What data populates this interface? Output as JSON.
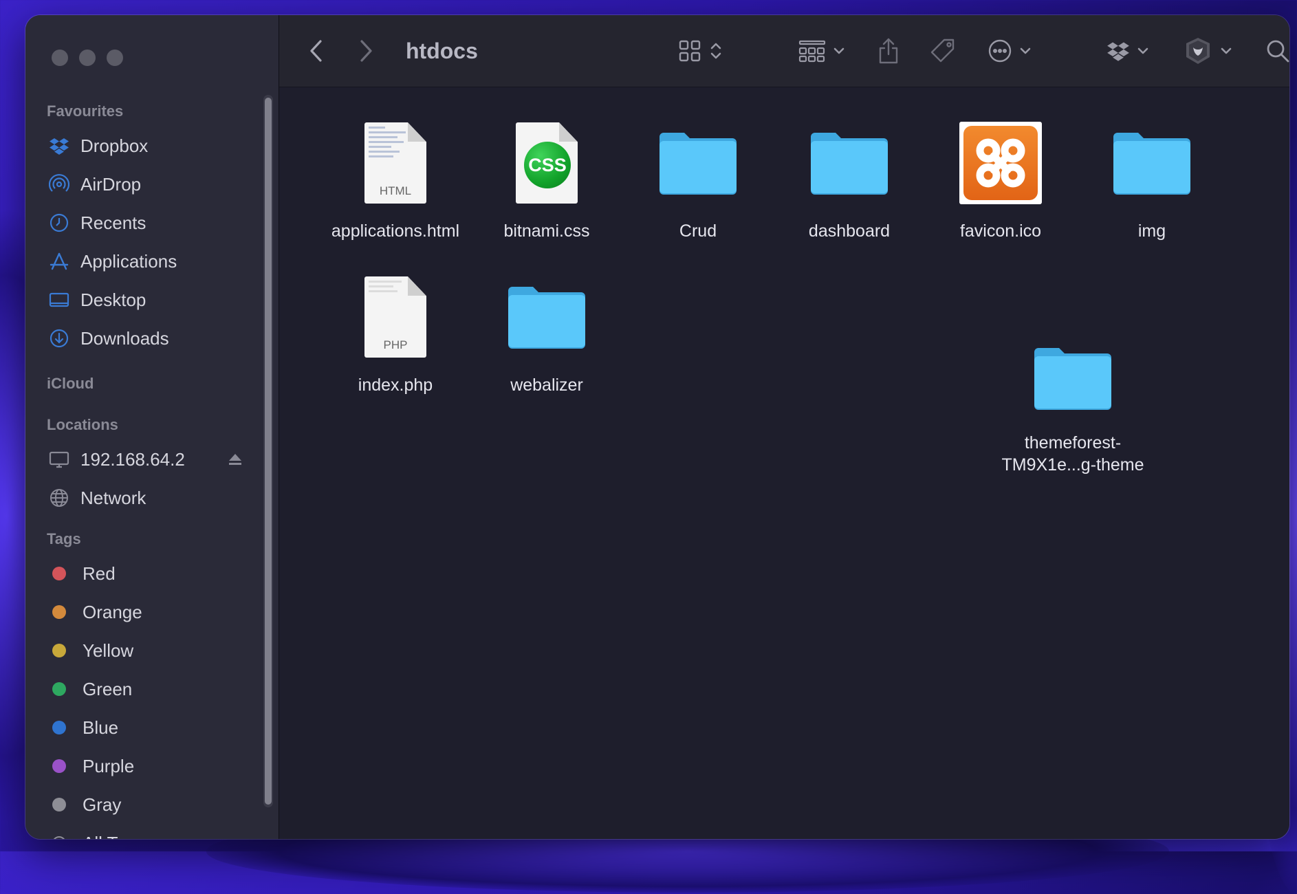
{
  "window": {
    "title": "htdocs"
  },
  "sidebar": {
    "sections": {
      "favourites": "Favourites",
      "icloud": "iCloud",
      "locations": "Locations",
      "tags": "Tags"
    },
    "favourites": [
      {
        "label": "Dropbox",
        "icon": "dropbox-icon"
      },
      {
        "label": "AirDrop",
        "icon": "airdrop-icon"
      },
      {
        "label": "Recents",
        "icon": "clock-icon"
      },
      {
        "label": "Applications",
        "icon": "applications-icon"
      },
      {
        "label": "Desktop",
        "icon": "desktop-icon"
      },
      {
        "label": "Downloads",
        "icon": "download-icon"
      }
    ],
    "locations": [
      {
        "label": "192.168.64.2",
        "icon": "computer-icon"
      },
      {
        "label": "Network",
        "icon": "globe-icon"
      }
    ],
    "tags": [
      {
        "label": "Red",
        "color": "#d4545a"
      },
      {
        "label": "Orange",
        "color": "#d48a3c"
      },
      {
        "label": "Yellow",
        "color": "#c8a83a"
      },
      {
        "label": "Green",
        "color": "#2ea860"
      },
      {
        "label": "Blue",
        "color": "#2f74d0"
      },
      {
        "label": "Purple",
        "color": "#9a52c8"
      },
      {
        "label": "Gray",
        "color": "#8e8e96"
      },
      {
        "label": "All Tags",
        "color": "#8e8e96"
      }
    ]
  },
  "files": [
    {
      "name": "applications.html",
      "type": "html",
      "ext": "HTML"
    },
    {
      "name": "bitnami.css",
      "type": "css",
      "badge": "CSS"
    },
    {
      "name": "Crud",
      "type": "folder"
    },
    {
      "name": "dashboard",
      "type": "folder"
    },
    {
      "name": "favicon.ico",
      "type": "xampp"
    },
    {
      "name": "img",
      "type": "folder"
    },
    {
      "name": "index.php",
      "type": "php",
      "ext": "PHP"
    },
    {
      "name": "webalizer",
      "type": "folder"
    },
    {
      "name_line1": "themeforest-",
      "name_line2": "TM9X1e...g-theme",
      "type": "folder"
    }
  ],
  "colors": {
    "folder": "#5ac8fa",
    "folder_dark": "#3ea8e0",
    "accent": "#3a7bd5"
  }
}
